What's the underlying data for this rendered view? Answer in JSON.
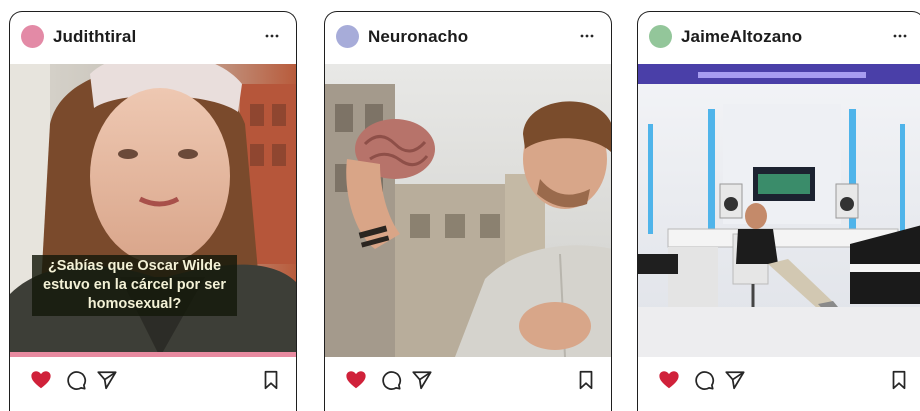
{
  "feed": {
    "posts": [
      {
        "username": "Judithtiral",
        "avatar_color": "#e38aa6",
        "caption_lines": [
          "¿Sabías que Oscar Wilde",
          "estuvo en la cárcel por ser",
          "homosexual?"
        ],
        "liked": true
      },
      {
        "username": "Neuronacho",
        "avatar_color": "#a7acd9",
        "liked": true
      },
      {
        "username": "JaimeAltozano",
        "avatar_color": "#93c69a",
        "liked": true
      }
    ]
  },
  "icons": {
    "more": "more-horizontal-icon",
    "like": "heart-icon",
    "comment": "comment-icon",
    "share": "paper-plane-icon",
    "save": "bookmark-icon"
  },
  "colors": {
    "liked_heart": "#d0213a",
    "icon_stroke": "#262626",
    "border": "#1f1f1f"
  }
}
